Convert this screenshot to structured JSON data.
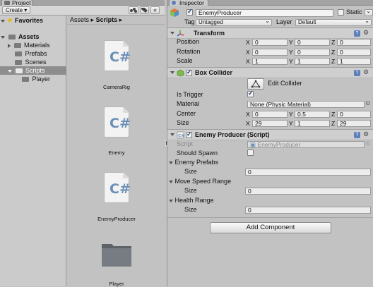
{
  "project": {
    "tab_label": "Project",
    "create_label": "Create",
    "favorites_label": "Favorites",
    "tree": {
      "assets": "Assets",
      "materials": "Materials",
      "prefabs": "Prefabs",
      "scenes": "Scenes",
      "scripts": "Scripts",
      "player": "Player"
    },
    "breadcrumb": {
      "root": "Assets",
      "sep": "▸",
      "current": "Scripts",
      "end": "▸"
    },
    "files": [
      {
        "name": "CameraRig",
        "icon": "csharp-file-icon"
      },
      {
        "name": "Enemy",
        "icon": "csharp-file-icon"
      },
      {
        "name": "EnemyProducer",
        "icon": "csharp-file-icon"
      },
      {
        "name": "Player",
        "icon": "folder-icon"
      }
    ]
  },
  "inspector": {
    "tab_label": "Inspector",
    "object_name": "EnemyProducer",
    "static_label": "Static",
    "tag_label": "Tag",
    "tag_value": "Untagged",
    "layer_label": "Layer",
    "layer_value": "Default",
    "transform": {
      "title": "Transform",
      "position_label": "Position",
      "rotation_label": "Rotation",
      "scale_label": "Scale",
      "position": {
        "x": "0",
        "y": "0",
        "z": "0"
      },
      "rotation": {
        "x": "0",
        "y": "0",
        "z": "0"
      },
      "scale": {
        "x": "1",
        "y": "1",
        "z": "1"
      }
    },
    "box_collider": {
      "title": "Box Collider",
      "edit_collider_label": "Edit Collider",
      "is_trigger_label": "Is Trigger",
      "material_label": "Material",
      "material_value": "None (Physic Material)",
      "center_label": "Center",
      "size_label": "Size",
      "center": {
        "x": "0",
        "y": "0.5",
        "z": "0"
      },
      "size": {
        "x": "29",
        "y": "1",
        "z": "29"
      }
    },
    "script_component": {
      "title": "Enemy Producer (Script)",
      "script_label": "Script",
      "script_value": "EnemyProducer",
      "should_spawn_label": "Should Spawn",
      "enemy_prefabs_label": "Enemy Prefabs",
      "enemy_prefabs_size": "0",
      "move_speed_label": "Move Speed Range",
      "move_speed_size": "0",
      "health_range_label": "Health Range",
      "health_range_size": "0",
      "size_label": "Size"
    },
    "add_component_label": "Add Component",
    "axis": {
      "x": "X",
      "y": "Y",
      "z": "Z"
    }
  },
  "colors": {
    "accent": "#5b7fbb",
    "selection": "#8d8d8d",
    "panel": "#c2c2c2"
  }
}
